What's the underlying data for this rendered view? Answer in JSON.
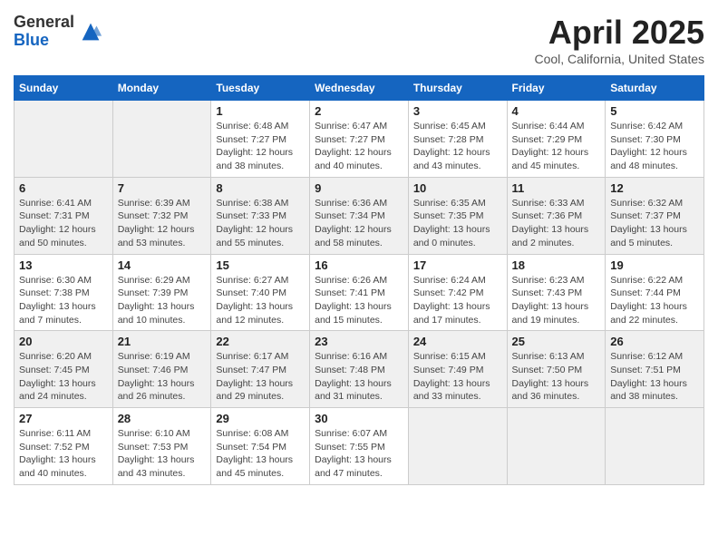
{
  "header": {
    "logo_general": "General",
    "logo_blue": "Blue",
    "title": "April 2025",
    "location": "Cool, California, United States"
  },
  "weekdays": [
    "Sunday",
    "Monday",
    "Tuesday",
    "Wednesday",
    "Thursday",
    "Friday",
    "Saturday"
  ],
  "weeks": [
    [
      {
        "day": "",
        "empty": true
      },
      {
        "day": "",
        "empty": true
      },
      {
        "day": "1",
        "sunrise": "Sunrise: 6:48 AM",
        "sunset": "Sunset: 7:27 PM",
        "daylight": "Daylight: 12 hours and 38 minutes."
      },
      {
        "day": "2",
        "sunrise": "Sunrise: 6:47 AM",
        "sunset": "Sunset: 7:27 PM",
        "daylight": "Daylight: 12 hours and 40 minutes."
      },
      {
        "day": "3",
        "sunrise": "Sunrise: 6:45 AM",
        "sunset": "Sunset: 7:28 PM",
        "daylight": "Daylight: 12 hours and 43 minutes."
      },
      {
        "day": "4",
        "sunrise": "Sunrise: 6:44 AM",
        "sunset": "Sunset: 7:29 PM",
        "daylight": "Daylight: 12 hours and 45 minutes."
      },
      {
        "day": "5",
        "sunrise": "Sunrise: 6:42 AM",
        "sunset": "Sunset: 7:30 PM",
        "daylight": "Daylight: 12 hours and 48 minutes."
      }
    ],
    [
      {
        "day": "6",
        "sunrise": "Sunrise: 6:41 AM",
        "sunset": "Sunset: 7:31 PM",
        "daylight": "Daylight: 12 hours and 50 minutes."
      },
      {
        "day": "7",
        "sunrise": "Sunrise: 6:39 AM",
        "sunset": "Sunset: 7:32 PM",
        "daylight": "Daylight: 12 hours and 53 minutes."
      },
      {
        "day": "8",
        "sunrise": "Sunrise: 6:38 AM",
        "sunset": "Sunset: 7:33 PM",
        "daylight": "Daylight: 12 hours and 55 minutes."
      },
      {
        "day": "9",
        "sunrise": "Sunrise: 6:36 AM",
        "sunset": "Sunset: 7:34 PM",
        "daylight": "Daylight: 12 hours and 58 minutes."
      },
      {
        "day": "10",
        "sunrise": "Sunrise: 6:35 AM",
        "sunset": "Sunset: 7:35 PM",
        "daylight": "Daylight: 13 hours and 0 minutes."
      },
      {
        "day": "11",
        "sunrise": "Sunrise: 6:33 AM",
        "sunset": "Sunset: 7:36 PM",
        "daylight": "Daylight: 13 hours and 2 minutes."
      },
      {
        "day": "12",
        "sunrise": "Sunrise: 6:32 AM",
        "sunset": "Sunset: 7:37 PM",
        "daylight": "Daylight: 13 hours and 5 minutes."
      }
    ],
    [
      {
        "day": "13",
        "sunrise": "Sunrise: 6:30 AM",
        "sunset": "Sunset: 7:38 PM",
        "daylight": "Daylight: 13 hours and 7 minutes."
      },
      {
        "day": "14",
        "sunrise": "Sunrise: 6:29 AM",
        "sunset": "Sunset: 7:39 PM",
        "daylight": "Daylight: 13 hours and 10 minutes."
      },
      {
        "day": "15",
        "sunrise": "Sunrise: 6:27 AM",
        "sunset": "Sunset: 7:40 PM",
        "daylight": "Daylight: 13 hours and 12 minutes."
      },
      {
        "day": "16",
        "sunrise": "Sunrise: 6:26 AM",
        "sunset": "Sunset: 7:41 PM",
        "daylight": "Daylight: 13 hours and 15 minutes."
      },
      {
        "day": "17",
        "sunrise": "Sunrise: 6:24 AM",
        "sunset": "Sunset: 7:42 PM",
        "daylight": "Daylight: 13 hours and 17 minutes."
      },
      {
        "day": "18",
        "sunrise": "Sunrise: 6:23 AM",
        "sunset": "Sunset: 7:43 PM",
        "daylight": "Daylight: 13 hours and 19 minutes."
      },
      {
        "day": "19",
        "sunrise": "Sunrise: 6:22 AM",
        "sunset": "Sunset: 7:44 PM",
        "daylight": "Daylight: 13 hours and 22 minutes."
      }
    ],
    [
      {
        "day": "20",
        "sunrise": "Sunrise: 6:20 AM",
        "sunset": "Sunset: 7:45 PM",
        "daylight": "Daylight: 13 hours and 24 minutes."
      },
      {
        "day": "21",
        "sunrise": "Sunrise: 6:19 AM",
        "sunset": "Sunset: 7:46 PM",
        "daylight": "Daylight: 13 hours and 26 minutes."
      },
      {
        "day": "22",
        "sunrise": "Sunrise: 6:17 AM",
        "sunset": "Sunset: 7:47 PM",
        "daylight": "Daylight: 13 hours and 29 minutes."
      },
      {
        "day": "23",
        "sunrise": "Sunrise: 6:16 AM",
        "sunset": "Sunset: 7:48 PM",
        "daylight": "Daylight: 13 hours and 31 minutes."
      },
      {
        "day": "24",
        "sunrise": "Sunrise: 6:15 AM",
        "sunset": "Sunset: 7:49 PM",
        "daylight": "Daylight: 13 hours and 33 minutes."
      },
      {
        "day": "25",
        "sunrise": "Sunrise: 6:13 AM",
        "sunset": "Sunset: 7:50 PM",
        "daylight": "Daylight: 13 hours and 36 minutes."
      },
      {
        "day": "26",
        "sunrise": "Sunrise: 6:12 AM",
        "sunset": "Sunset: 7:51 PM",
        "daylight": "Daylight: 13 hours and 38 minutes."
      }
    ],
    [
      {
        "day": "27",
        "sunrise": "Sunrise: 6:11 AM",
        "sunset": "Sunset: 7:52 PM",
        "daylight": "Daylight: 13 hours and 40 minutes."
      },
      {
        "day": "28",
        "sunrise": "Sunrise: 6:10 AM",
        "sunset": "Sunset: 7:53 PM",
        "daylight": "Daylight: 13 hours and 43 minutes."
      },
      {
        "day": "29",
        "sunrise": "Sunrise: 6:08 AM",
        "sunset": "Sunset: 7:54 PM",
        "daylight": "Daylight: 13 hours and 45 minutes."
      },
      {
        "day": "30",
        "sunrise": "Sunrise: 6:07 AM",
        "sunset": "Sunset: 7:55 PM",
        "daylight": "Daylight: 13 hours and 47 minutes."
      },
      {
        "day": "",
        "empty": true
      },
      {
        "day": "",
        "empty": true
      },
      {
        "day": "",
        "empty": true
      }
    ]
  ]
}
